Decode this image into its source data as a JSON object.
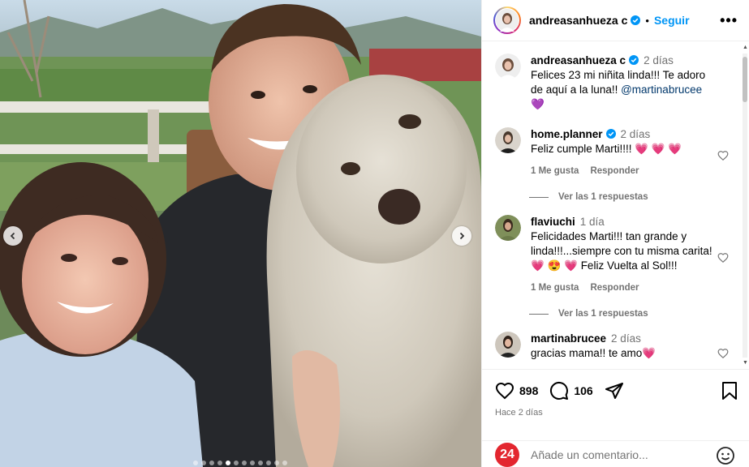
{
  "post": {
    "author": "andreasanhueza c",
    "follow_label": "Seguir",
    "separator": "•",
    "more_label": "•••",
    "caption_time": "2 días",
    "caption_text": "Felices 23 mi niñita linda!!! Te adoro de aquí a la luna!! ",
    "caption_mention": "@martinabrucee",
    "caption_emoji": "💜",
    "likes": "898",
    "comments_count": "106",
    "posted_ago": "Hace 2 días"
  },
  "comments": [
    {
      "user": "home.planner",
      "verified": true,
      "time": "2 días",
      "text": "Feliz cumple Marti!!!! ",
      "emoji": "💗 💗 💗",
      "likes_label": "1 Me gusta",
      "reply_label": "Responder",
      "replies_label": "Ver las 1 respuestas"
    },
    {
      "user": "flaviuchi",
      "time": "1 día",
      "text": "Felicidades Marti!!! tan grande y linda!!!...siempre con tu misma carita! ",
      "emoji": "💗 😍 💗",
      "text2": " Feliz Vuelta al Sol!!!",
      "likes_label": "1 Me gusta",
      "reply_label": "Responder",
      "replies_label": "Ver las 1 respuestas"
    },
    {
      "user": "martinabrucee",
      "time": "2 días",
      "text": "gracias mama!! te amo",
      "emoji": "💗"
    }
  ],
  "add_comment": {
    "badge": "24",
    "placeholder": "Añade un comentario..."
  },
  "carousel": {
    "slides": 12,
    "active": 4
  },
  "colors": {
    "accent": "#0095f6",
    "mention": "#00376b",
    "muted": "#737373",
    "badge": "#e3262f"
  }
}
